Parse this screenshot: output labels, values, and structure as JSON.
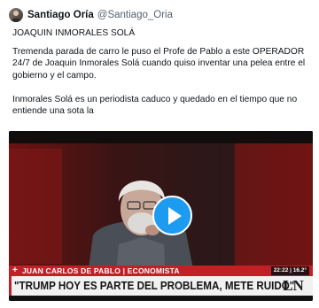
{
  "tweet": {
    "author": {
      "display_name": "Santiago Oría",
      "handle": "@Santiago_Oria"
    },
    "text": {
      "line1": "JOAQUIN INMORALES SOLÁ",
      "paragraph1": "Tremenda parada de carro le puso el Profe de Pablo a este OPERADOR 24/7 de Joaquin Inmorales Solá cuando quiso inventar una pelea entre el gobierno y el campo.",
      "paragraph2": "Inmorales Solá es un periodista caduco y quedado en el tiempo que no entiende una sota la"
    }
  },
  "video": {
    "play_icon": "play-triangle-icon",
    "lower_third": {
      "plus_sign": "+",
      "name": "JUAN CARLOS DE PABLO | ECONOMISTA",
      "clock": "22:22 | 16.2°",
      "headline": "\"TRUMP HOY ES PARTE DEL PROBLEMA, METE RUIDO\"",
      "logo": "LN"
    },
    "colors": {
      "play_button": "#1d9bf0",
      "name_bar": "#c32026",
      "headline_bar": "#f1f1f1"
    }
  }
}
